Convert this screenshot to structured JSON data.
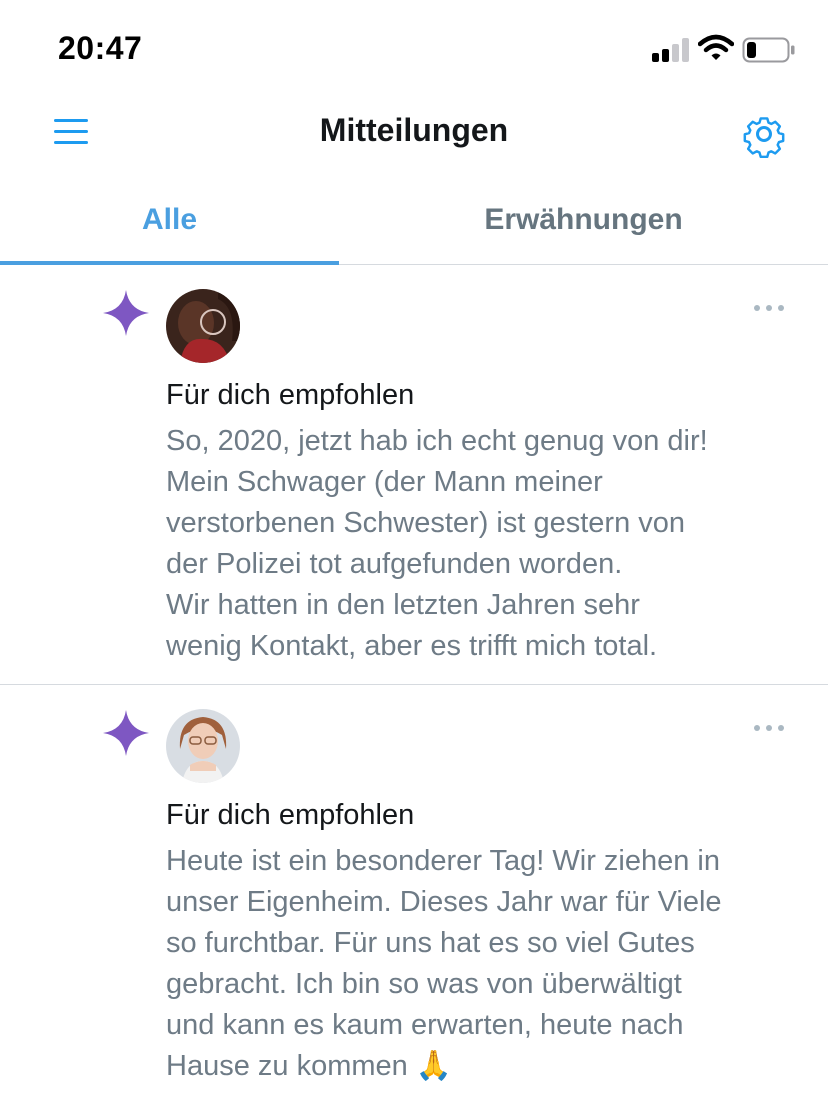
{
  "status_bar": {
    "time": "20:47",
    "signal_icon": "cellular-signal-icon",
    "wifi_icon": "wifi-icon",
    "battery_icon": "battery-icon",
    "battery_level": 0.2
  },
  "header": {
    "title": "Mitteilungen",
    "menu_icon": "hamburger-menu-icon",
    "settings_icon": "gear-icon"
  },
  "tabs": [
    {
      "label": "Alle",
      "active": true
    },
    {
      "label": "Erwähnungen",
      "active": false
    }
  ],
  "notifications": [
    {
      "icon": "sparkle-icon",
      "label": "Für dich empfohlen",
      "text_lines": [
        "So, 2020, jetzt hab ich echt genug von dir!",
        "Mein Schwager (der Mann meiner",
        "verstorbenen Schwester) ist gestern von",
        "der Polizei tot aufgefunden worden.",
        "Wir hatten in den letzten Jahren sehr",
        "wenig Kontakt, aber es trifft mich total."
      ]
    },
    {
      "icon": "sparkle-icon",
      "label": "Für dich empfohlen",
      "text_lines": [
        "Heute ist ein besonderer Tag! Wir ziehen in",
        "unser Eigenheim. Dieses Jahr war für Viele",
        "so furchtbar. Für uns hat es so viel Gutes",
        "gebracht. Ich bin so was von überwältigt",
        "und kann es kaum erwarten, heute nach",
        "Hause zu kommen 🙏"
      ]
    }
  ],
  "colors": {
    "accent": "#4a9fe0",
    "sparkle": "#7e57c2",
    "secondary_text": "#6e7b86",
    "divider": "#d6dadf"
  }
}
